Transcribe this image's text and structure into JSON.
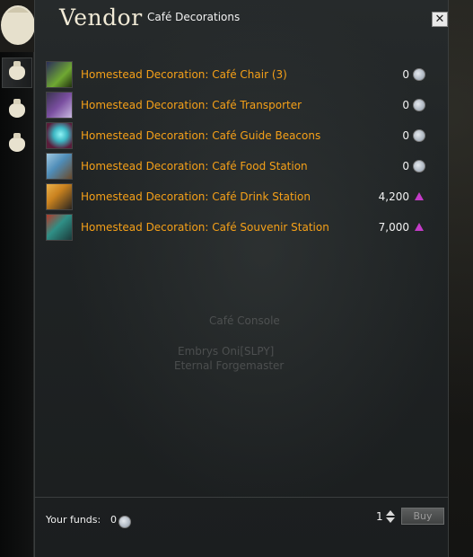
{
  "vendor": {
    "title": "Vendor",
    "subtitle": "Café Decorations",
    "close_label": "✕"
  },
  "items": [
    {
      "name": "Homestead Decoration: Café Chair (3)",
      "price": "0",
      "currency": "karma-icon",
      "icon_color": "#6fa832"
    },
    {
      "name": "Homestead Decoration: Café Transporter",
      "price": "0",
      "currency": "karma-icon",
      "icon_color": "#7a4fa0"
    },
    {
      "name": "Homestead Decoration: Café Guide Beacons",
      "price": "0",
      "currency": "karma-icon",
      "icon_color": "#3db6c3"
    },
    {
      "name": "Homestead Decoration: Café Food Station",
      "price": "0",
      "currency": "karma-icon",
      "icon_color": "#4f8db8"
    },
    {
      "name": "Homestead Decoration: Café Drink Station",
      "price": "4,200",
      "currency": "triangle-currency-icon",
      "icon_color": "#c9821f"
    },
    {
      "name": "Homestead Decoration: Café Souvenir Station",
      "price": "7,000",
      "currency": "triangle-currency-icon",
      "icon_color": "#2f8f86"
    }
  ],
  "ghost": {
    "npc_label": "Café Console",
    "player_name": "Embrys Oni[SLPY]",
    "player_title": "Eternal Forgemaster"
  },
  "footer": {
    "funds_label": "Your funds:",
    "funds_value": "0",
    "quantity": "1",
    "buy_label": "Buy"
  }
}
